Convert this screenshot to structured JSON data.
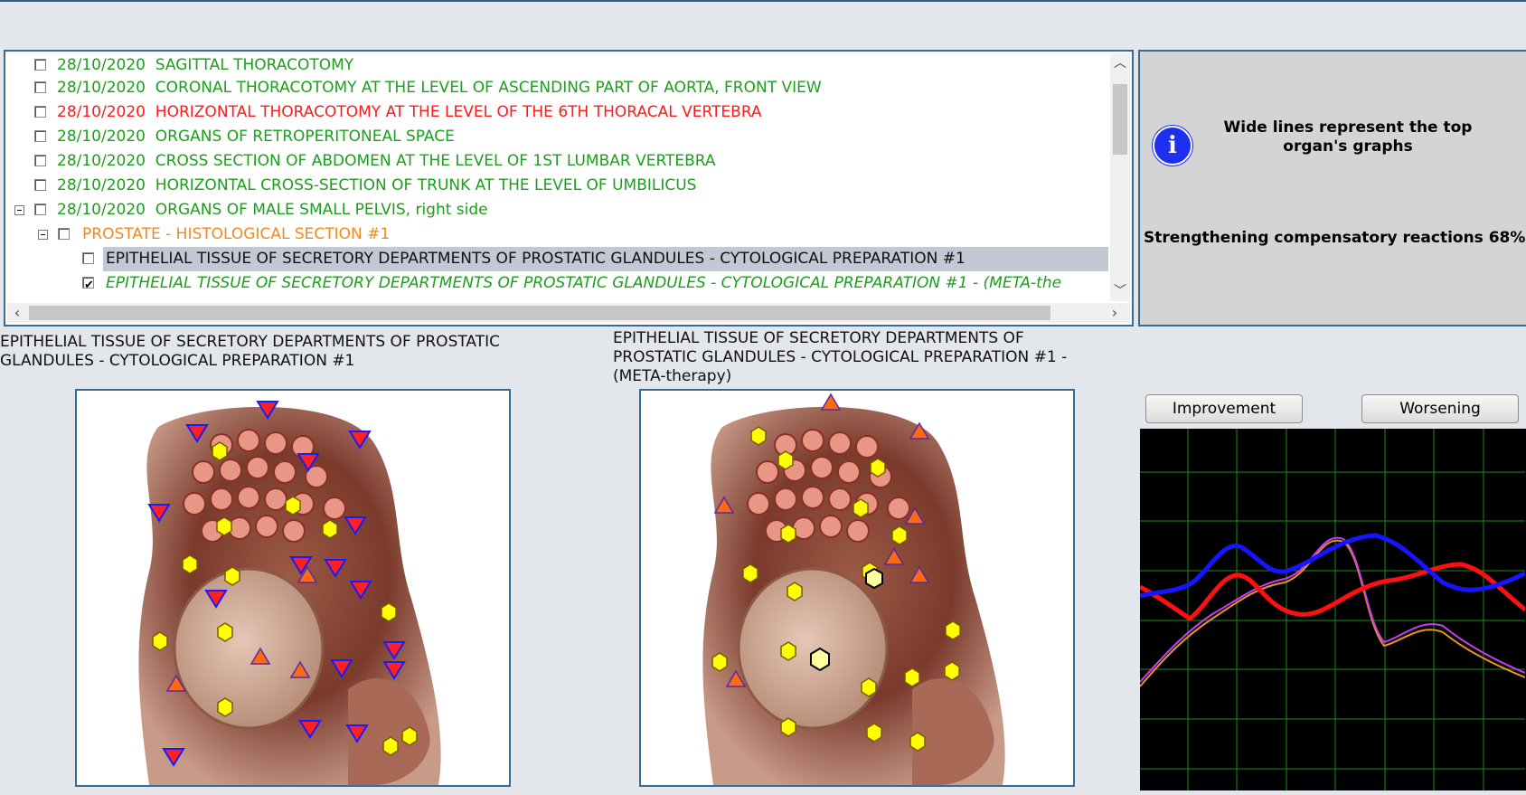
{
  "tree": {
    "rows": [
      {
        "date": "28/10/2020",
        "label": "SAGITTAL THORACOTOMY",
        "color": "green",
        "checked": false
      },
      {
        "date": "28/10/2020",
        "label": "CORONAL THORACOTOMY AT THE LEVEL OF ASCENDING PART OF AORTA, FRONT VIEW",
        "color": "green",
        "checked": false
      },
      {
        "date": "28/10/2020",
        "label": "HORIZONTAL THORACOTOMY AT THE LEVEL OF THE 6TH THORACAL VERTEBRA",
        "color": "red",
        "checked": false
      },
      {
        "date": "28/10/2020",
        "label": "ORGANS OF RETROPERITONEAL SPACE",
        "color": "green",
        "checked": false
      },
      {
        "date": "28/10/2020",
        "label": "CROSS SECTION OF ABDOMEN AT THE LEVEL OF 1ST LUMBAR VERTEBRA",
        "color": "green",
        "checked": false
      },
      {
        "date": "28/10/2020",
        "label": "HORIZONTAL CROSS-SECTION OF TRUNK AT THE LEVEL OF UMBILICUS",
        "color": "green",
        "checked": false
      },
      {
        "date": "28/10/2020",
        "label": "ORGANS OF MALE SMALL PELVIS, right side",
        "color": "green",
        "checked": false
      }
    ],
    "sub1": {
      "label": "PROSTATE - HISTOLOGICAL SECTION #1"
    },
    "sub2": {
      "label": "EPITHELIAL TISSUE OF SECRETORY DEPARTMENTS OF PROSTATIC GLANDULES - CYTOLOGICAL PREPARATION #1"
    },
    "sub3": {
      "label": "EPITHELIAL TISSUE OF SECRETORY DEPARTMENTS OF PROSTATIC GLANDULES - CYTOLOGICAL PREPARATION #1 - (META-the"
    }
  },
  "info": {
    "icon": "i",
    "message": "Wide lines represent the top organ's graphs",
    "stat": "Strengthening compensatory reactions 68%"
  },
  "captions": {
    "left": "EPITHELIAL TISSUE OF SECRETORY DEPARTMENTS OF PROSTATIC GLANDULES - CYTOLOGICAL PREPARATION #1",
    "right": "EPITHELIAL TISSUE OF SECRETORY DEPARTMENTS OF PROSTATIC GLANDULES - CYTOLOGICAL PREPARATION #1 - (META-therapy)"
  },
  "graph": {
    "improvement_label": "Improvement",
    "worsening_label": "Worsening"
  },
  "colors": {
    "green": "#1e9e1e",
    "red": "#ff1a1a",
    "orange": "#f08a1e",
    "frame": "#3b6a93",
    "info_blue": "#1e2ff0"
  }
}
